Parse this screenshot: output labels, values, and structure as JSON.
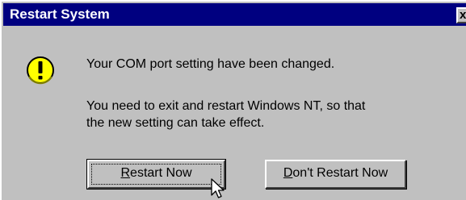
{
  "window": {
    "title": "Restart System",
    "close_glyph": "x"
  },
  "message": {
    "line1": "Your COM port setting have been changed.",
    "line2": "You need to exit and restart Windows NT, so that",
    "line3": "the new setting can take effect."
  },
  "icons": {
    "warning": "exclamation-warning-icon",
    "cursor": "arrow-cursor-icon"
  },
  "buttons": {
    "restart_now": {
      "accel": "R",
      "rest": "estart Now"
    },
    "dont_restart_now": {
      "accel": "D",
      "rest": "on't Restart Now"
    }
  },
  "colors": {
    "titlebar": "#000080",
    "face": "#c0c0c0",
    "warning_fill": "#ffff00"
  }
}
